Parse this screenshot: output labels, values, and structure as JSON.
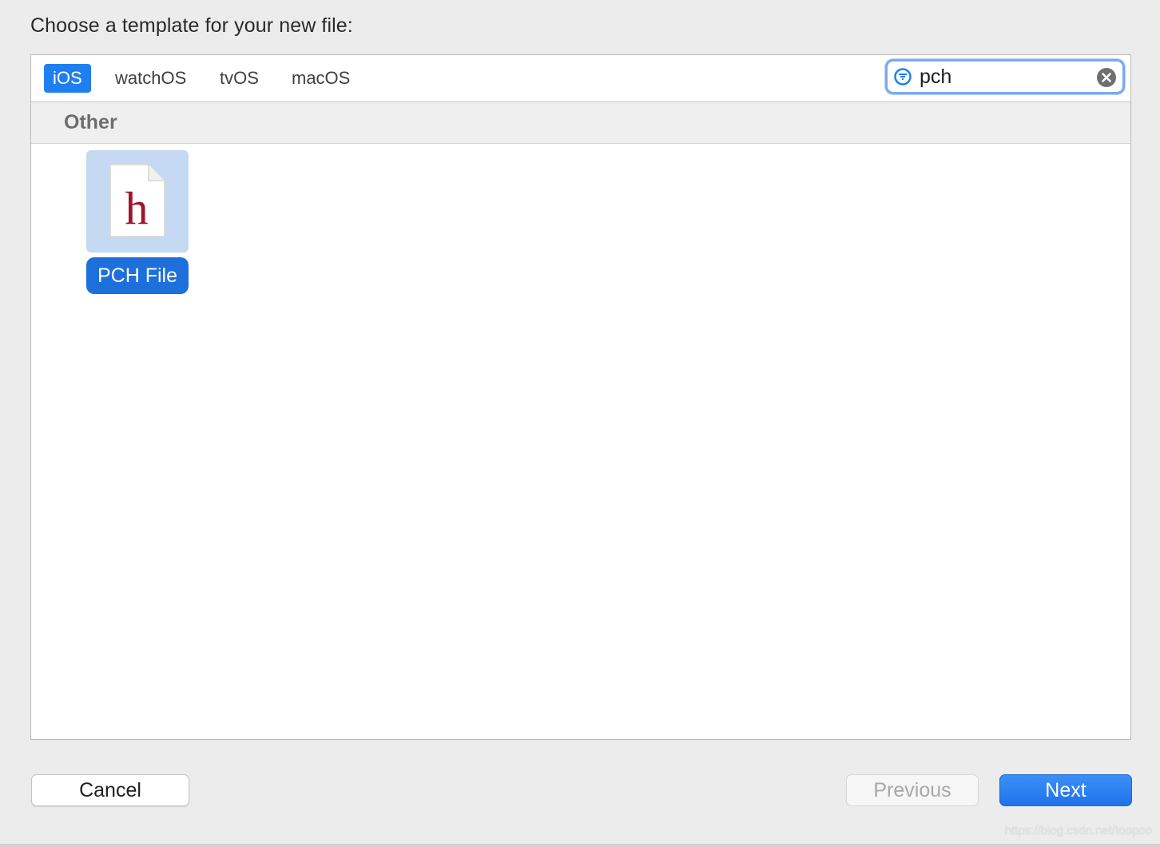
{
  "dialog": {
    "title": "Choose a template for your new file:"
  },
  "platform_tabs": [
    {
      "label": "iOS",
      "selected": true
    },
    {
      "label": "watchOS",
      "selected": false
    },
    {
      "label": "tvOS",
      "selected": false
    },
    {
      "label": "macOS",
      "selected": false
    }
  ],
  "search": {
    "value": "pch",
    "icon": "filter-icon",
    "clear_icon": "clear-icon"
  },
  "section": {
    "title": "Other"
  },
  "templates": [
    {
      "label": "PCH File",
      "icon": "header-file-icon",
      "glyph": "h",
      "selected": true
    }
  ],
  "buttons": {
    "cancel": "Cancel",
    "previous": "Previous",
    "next": "Next"
  },
  "watermark": "https://blog.csdn.net/toopoo",
  "colors": {
    "accent": "#1f7ff0",
    "selection": "#c5d9f3",
    "glyph": "#a0142a"
  }
}
